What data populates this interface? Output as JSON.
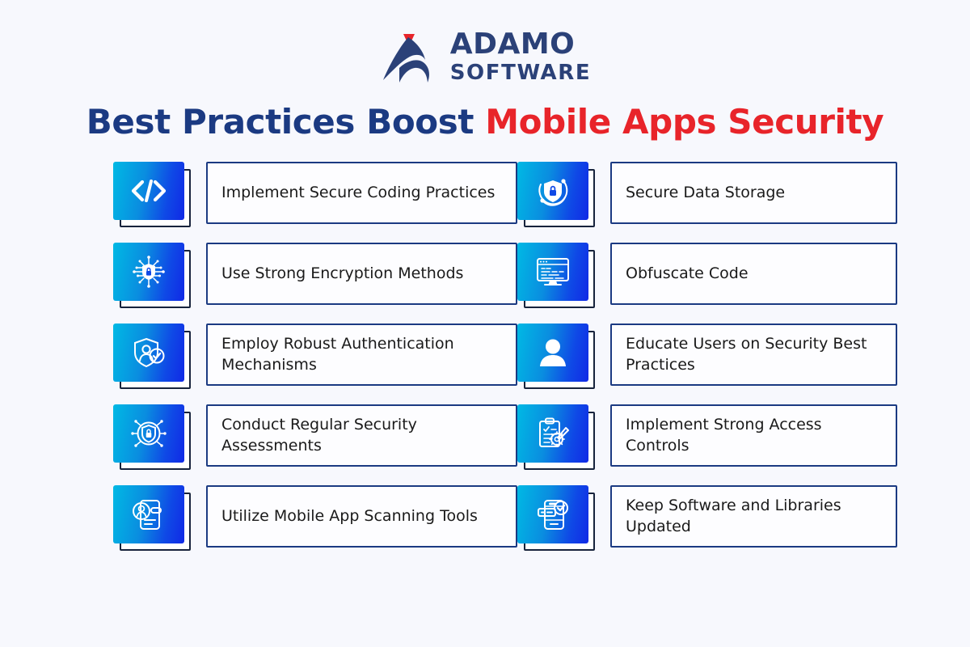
{
  "brand": {
    "logo_icon": "adamo-mountain-arrow-logo",
    "name_line1": "ADAMO",
    "name_line2": "SOFTWARE",
    "navy": "#2b4178",
    "red": "#e8242a"
  },
  "title": {
    "part_navy": "Best Practices Boost ",
    "part_red": "Mobile Apps Security",
    "navy_color": "#1b3a82",
    "red_color": "#e8242a"
  },
  "theme": {
    "background": "#f7f8fd",
    "tile_gradient_from": "#00b9e4",
    "tile_gradient_to": "#1129e6",
    "box_border": "#1b3a82",
    "shadow_card_border": "#17233c"
  },
  "left_column": [
    {
      "icon": "code-brackets-icon",
      "label": "Implement Secure Coding Practices"
    },
    {
      "icon": "encryption-lock-shield-icon",
      "label": "Use Strong Encryption Methods"
    },
    {
      "icon": "shield-user-check-icon",
      "label": "Employ Robust Authentication Mechanisms"
    },
    {
      "icon": "circular-shield-lock-icon",
      "label": "Conduct Regular Security Assessments"
    },
    {
      "icon": "mobile-user-scan-icon",
      "label": "Utilize Mobile App Scanning Tools"
    }
  ],
  "right_column": [
    {
      "icon": "orbit-shield-lock-icon",
      "label": "Secure Data Storage"
    },
    {
      "icon": "monitor-code-icon",
      "label": "Obfuscate Code"
    },
    {
      "icon": "user-person-icon",
      "label": "Educate Users on Security Best Practices"
    },
    {
      "icon": "clipboard-gear-pencil-icon",
      "label": "Implement Strong Access Controls"
    },
    {
      "icon": "mobile-check-update-icon",
      "label": "Keep Software and Libraries Updated"
    }
  ]
}
